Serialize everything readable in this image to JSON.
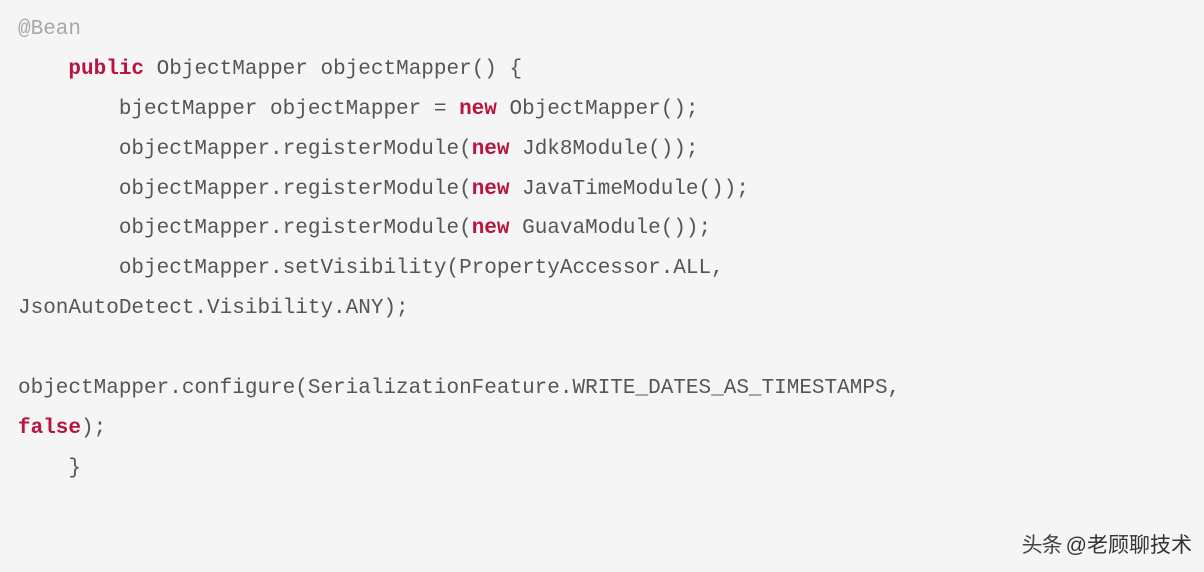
{
  "code": {
    "l1_annotation": "@Bean",
    "l2_pre": "    ",
    "l2_public": "public",
    "l2_rest": " ObjectMapper objectMapper() {",
    "l3_pre": "        bjectMapper objectMapper = ",
    "l3_new": "new",
    "l3_rest": " ObjectMapper();",
    "l4_pre": "        objectMapper.registerModule(",
    "l4_new": "new",
    "l4_rest": " Jdk8Module());",
    "l5_pre": "        objectMapper.registerModule(",
    "l5_new": "new",
    "l5_rest": " JavaTimeModule());",
    "l6_pre": "        objectMapper.registerModule(",
    "l6_new": "new",
    "l6_rest": " GuavaModule());",
    "l7": "        objectMapper.setVisibility(PropertyAccessor.ALL,",
    "l8": "JsonAutoDetect.Visibility.ANY);",
    "l9": "",
    "l10": "objectMapper.configure(SerializationFeature.WRITE_DATES_AS_TIMESTAMPS,",
    "l11_false": "false",
    "l11_rest": ");",
    "l12": "    }"
  },
  "watermark": {
    "prefix": "头条",
    "handle": "@老顾聊技术"
  }
}
